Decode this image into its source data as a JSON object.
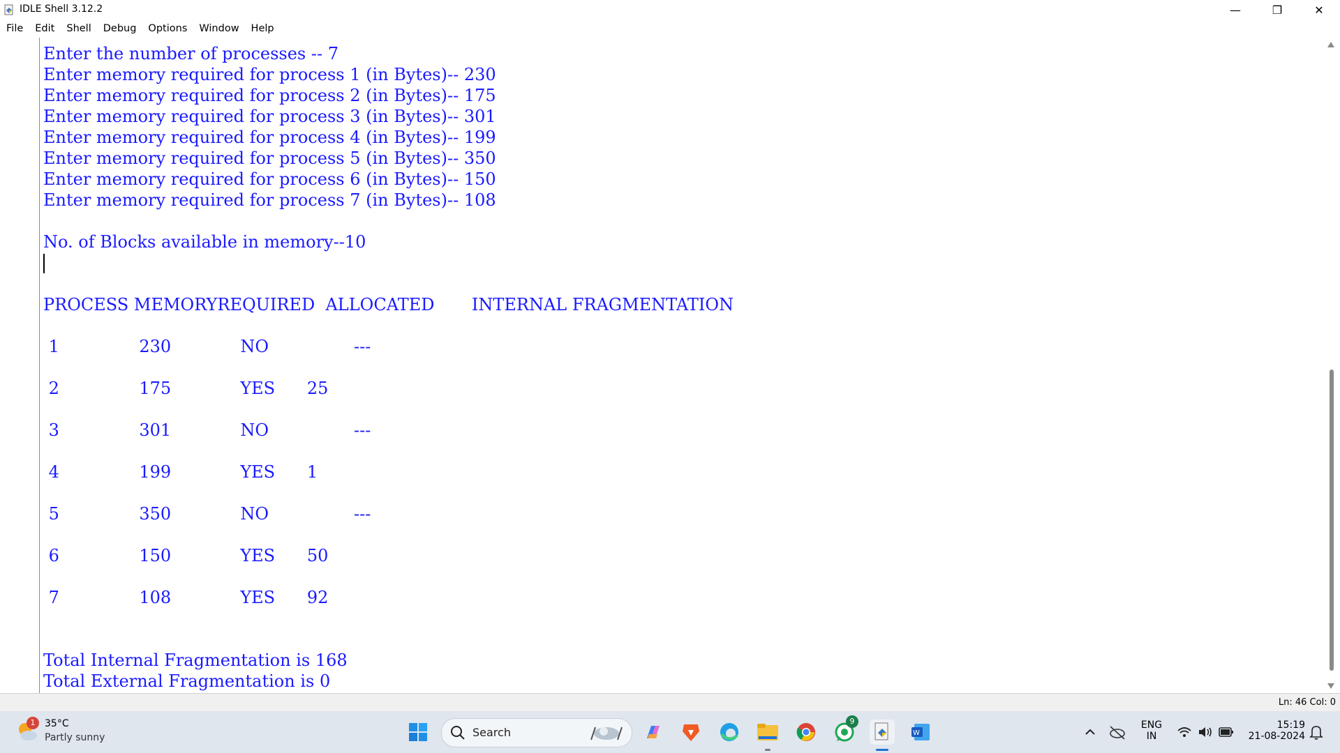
{
  "window": {
    "title": "IDLE Shell 3.12.2",
    "minimize_glyph": "—",
    "maximize_glyph": "❐",
    "close_glyph": "✕"
  },
  "menu": [
    "File",
    "Edit",
    "Shell",
    "Debug",
    "Options",
    "Window",
    "Help"
  ],
  "shell": {
    "text_color": "#1a1aff",
    "lines": [
      "Enter the number of processes -- 7",
      "Enter memory required for process 1 (in Bytes)-- 230",
      "Enter memory required for process 2 (in Bytes)-- 175",
      "Enter memory required for process 3 (in Bytes)-- 301",
      "Enter memory required for process 4 (in Bytes)-- 199",
      "Enter memory required for process 5 (in Bytes)-- 350",
      "Enter memory required for process 6 (in Bytes)-- 150",
      "Enter memory required for process 7 (in Bytes)-- 108",
      "No. of Blocks available in memory--10",
      "PROCESS MEMORYREQUIRED  ALLOCATED       INTERNAL FRAGMENTATION",
      " 1               230             NO                ---",
      " 2               175             YES      25",
      " 3               301             NO                ---",
      " 4               199             YES      1",
      " 5               350             NO                ---",
      " 6               150             YES      50",
      " 7               108             YES      92",
      "Total Internal Fragmentation is 168",
      "Total External Fragmentation is 0"
    ]
  },
  "status": {
    "position": "Ln: 46  Col: 0"
  },
  "taskbar": {
    "weather_temp": "35°C",
    "weather_desc": "Partly sunny",
    "weather_badge": "1",
    "search_label": "Search",
    "whatsapp_badge": "9",
    "lang_top": "ENG",
    "lang_bottom": "IN",
    "time": "15:19",
    "date": "21-08-2024"
  }
}
